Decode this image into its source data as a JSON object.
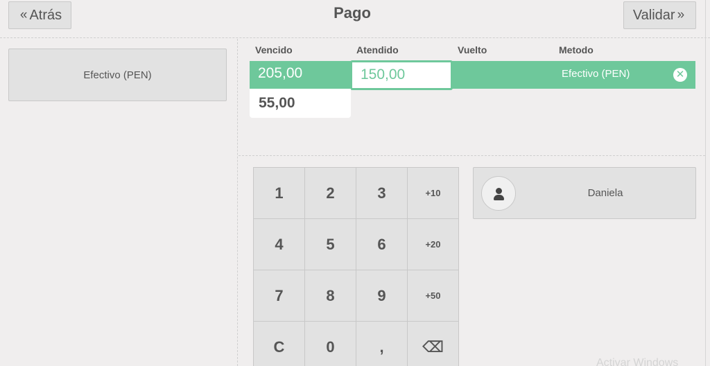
{
  "header": {
    "back_label": "Atrás",
    "title": "Pago",
    "validate_label": "Validar"
  },
  "payment_methods": [
    {
      "label": "Efectivo (PEN)"
    }
  ],
  "lines": {
    "columns": [
      "Vencido",
      "Atendido",
      "Vuelto",
      "Metodo"
    ],
    "selected_line": {
      "due": "205,00",
      "tendered": "150,00",
      "change": "",
      "method": "Efectivo (PEN)"
    },
    "remaining": "55,00"
  },
  "numpad": {
    "keys": [
      "1",
      "2",
      "3",
      "+10",
      "4",
      "5",
      "6",
      "+20",
      "7",
      "8",
      "9",
      "+50",
      "C",
      "0",
      ",",
      "⌫"
    ]
  },
  "customer": {
    "name": "Daniela"
  },
  "watermark": "Activar Windows"
}
